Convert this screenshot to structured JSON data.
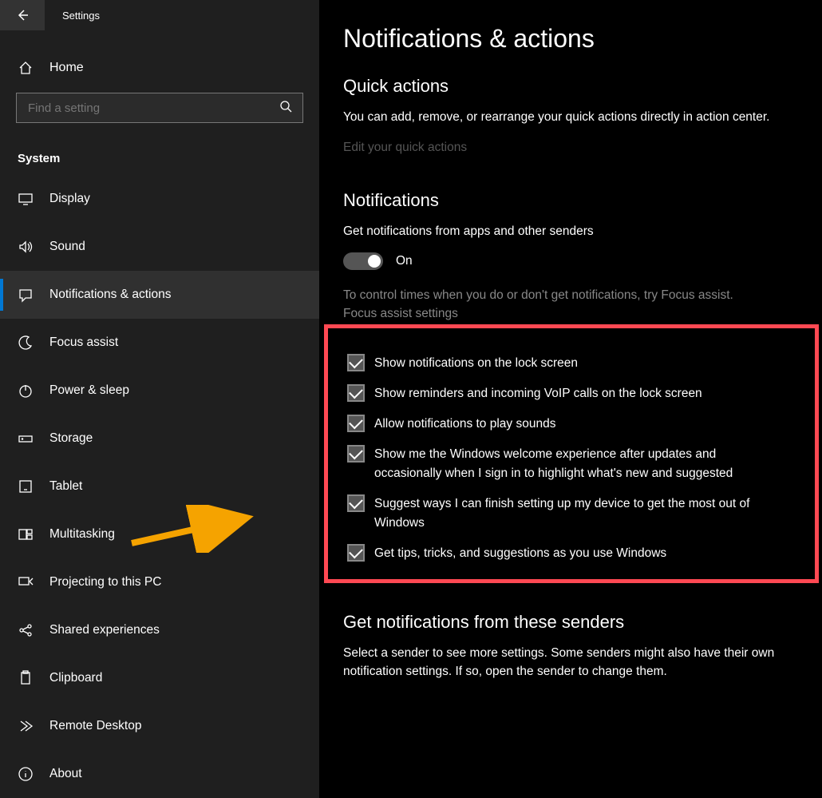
{
  "header": {
    "window_title": "Settings",
    "home_label": "Home",
    "search_placeholder": "Find a setting",
    "category": "System"
  },
  "sidebar": {
    "items": [
      {
        "id": "display",
        "label": "Display",
        "icon": "display-icon"
      },
      {
        "id": "sound",
        "label": "Sound",
        "icon": "sound-icon"
      },
      {
        "id": "notifications",
        "label": "Notifications & actions",
        "icon": "notification-icon",
        "selected": true
      },
      {
        "id": "focus-assist",
        "label": "Focus assist",
        "icon": "moon-icon"
      },
      {
        "id": "power-sleep",
        "label": "Power & sleep",
        "icon": "power-icon"
      },
      {
        "id": "storage",
        "label": "Storage",
        "icon": "storage-icon"
      },
      {
        "id": "tablet",
        "label": "Tablet",
        "icon": "tablet-icon"
      },
      {
        "id": "multitasking",
        "label": "Multitasking",
        "icon": "multitasking-icon"
      },
      {
        "id": "projecting",
        "label": "Projecting to this PC",
        "icon": "projecting-icon"
      },
      {
        "id": "shared-exp",
        "label": "Shared experiences",
        "icon": "shared-icon"
      },
      {
        "id": "clipboard",
        "label": "Clipboard",
        "icon": "clipboard-icon"
      },
      {
        "id": "remote-desktop",
        "label": "Remote Desktop",
        "icon": "remote-icon"
      },
      {
        "id": "about",
        "label": "About",
        "icon": "about-icon"
      }
    ]
  },
  "main": {
    "page_title": "Notifications & actions",
    "quick_actions": {
      "heading": "Quick actions",
      "description": "You can add, remove, or rearrange your quick actions directly in action center.",
      "link": "Edit your quick actions"
    },
    "notifications": {
      "heading": "Notifications",
      "toggle_desc": "Get notifications from apps and other senders",
      "toggle_state_label": "On",
      "toggle_on": true,
      "focus_text": "To control times when you do or don't get notifications, try Focus assist.",
      "focus_link": "Focus assist settings",
      "checkboxes": [
        {
          "label": "Show notifications on the lock screen",
          "checked": true
        },
        {
          "label": "Show reminders and incoming VoIP calls on the lock screen",
          "checked": true
        },
        {
          "label": "Allow notifications to play sounds",
          "checked": true
        },
        {
          "label": "Show me the Windows welcome experience after updates and occasionally when I sign in to highlight what's new and suggested",
          "checked": true
        },
        {
          "label": "Suggest ways I can finish setting up my device to get the most out of Windows",
          "checked": true
        },
        {
          "label": "Get tips, tricks, and suggestions as you use Windows",
          "checked": true
        }
      ]
    },
    "senders": {
      "heading": "Get notifications from these senders",
      "description": "Select a sender to see more settings. Some senders might also have their own notification settings. If so, open the sender to change them."
    }
  }
}
